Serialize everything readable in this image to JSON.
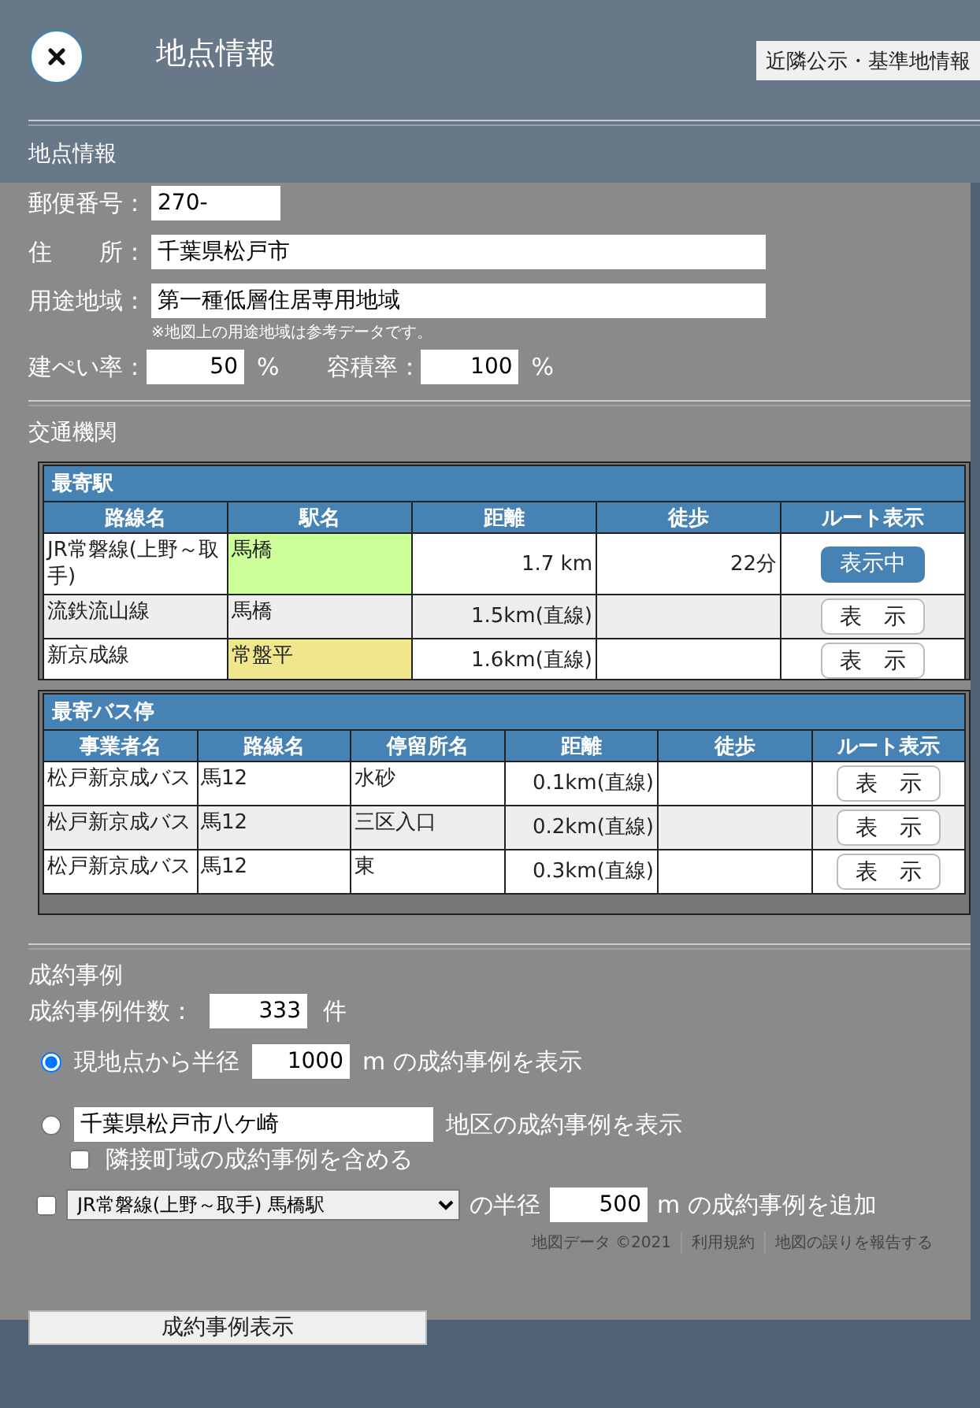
{
  "header": {
    "title": "地点情報",
    "neighbor_button": "近隣公示・基準地情報"
  },
  "location": {
    "heading": "地点情報",
    "fields": [
      {
        "label": "郵便番号：",
        "value": "270-",
        "kind": "short"
      },
      {
        "label": "住　　所：",
        "value": "千葉県松戸市",
        "kind": "long"
      },
      {
        "label": "用途地域：",
        "value": "第一種低層住居専用地域",
        "kind": "long"
      }
    ],
    "note": "※地図上の用途地域は参考データです。",
    "rates": [
      {
        "label": "建ぺい率：",
        "value": "50",
        "unit": "%"
      },
      {
        "label": "容積率：",
        "value": "100",
        "unit": "%"
      }
    ]
  },
  "transit": {
    "heading": "交通機関",
    "tables": [
      {
        "kind": "station",
        "title": "最寄駅",
        "columns": [
          "路線名",
          "駅名",
          "距離",
          "徒歩",
          "ルート表示"
        ],
        "rows": [
          {
            "line": "JR常磐線(上野～取手)",
            "station": "馬橋",
            "color": "#ccff99",
            "distance": "1.7 km",
            "walk": "22分",
            "route": "表示中",
            "active": true
          },
          {
            "line": "流鉄流山線",
            "station": "馬橋",
            "distance": "1.5km(直線)",
            "route": "表　示",
            "active": false
          },
          {
            "line": "新京成線",
            "station": "常盤平",
            "color": "#f0e68c",
            "distance": "1.6km(直線)",
            "route": "表　示",
            "active": false
          }
        ]
      },
      {
        "kind": "bus",
        "title": "最寄バス停",
        "columns": [
          "事業者名",
          "路線名",
          "停留所名",
          "距離",
          "徒歩",
          "ルート表示"
        ],
        "rows": [
          {
            "operator": "松戸新京成バス",
            "line": "馬12",
            "stop": "水砂",
            "distance": "0.1km(直線)",
            "route": "表　示",
            "active": false
          },
          {
            "operator": "松戸新京成バス",
            "line": "馬12",
            "stop": "三区入口",
            "distance": "0.2km(直線)",
            "route": "表　示",
            "active": false
          },
          {
            "operator": "松戸新京成バス",
            "line": "馬12",
            "stop": "東",
            "distance": "0.3km(直線)",
            "route": "表　示",
            "active": false
          }
        ]
      }
    ]
  },
  "deals": {
    "heading": "成約事例",
    "count": {
      "label": "成約事例件数：",
      "value": "333",
      "unit": "件"
    },
    "radius_option": {
      "selected": true,
      "prefix": "現地点から半径",
      "value": "1000",
      "suffix": "m の成約事例を表示"
    },
    "area_option": {
      "selected": false,
      "value": "千葉県松戸市八ケ崎",
      "suffix": "地区の成約事例を表示",
      "include_adjacent": {
        "checked": false,
        "label": "隣接町域の成約事例を含める"
      }
    },
    "station_option": {
      "checked": false,
      "station": "JR常磐線(上野～取手) 馬橋駅",
      "middle": "の半径",
      "value": "500",
      "suffix": "m の成約事例を追加"
    },
    "map_credits": [
      "地図データ ©2021",
      "利用規約",
      "地図の誤りを報告する"
    ],
    "show_button": "成約事例表示"
  }
}
